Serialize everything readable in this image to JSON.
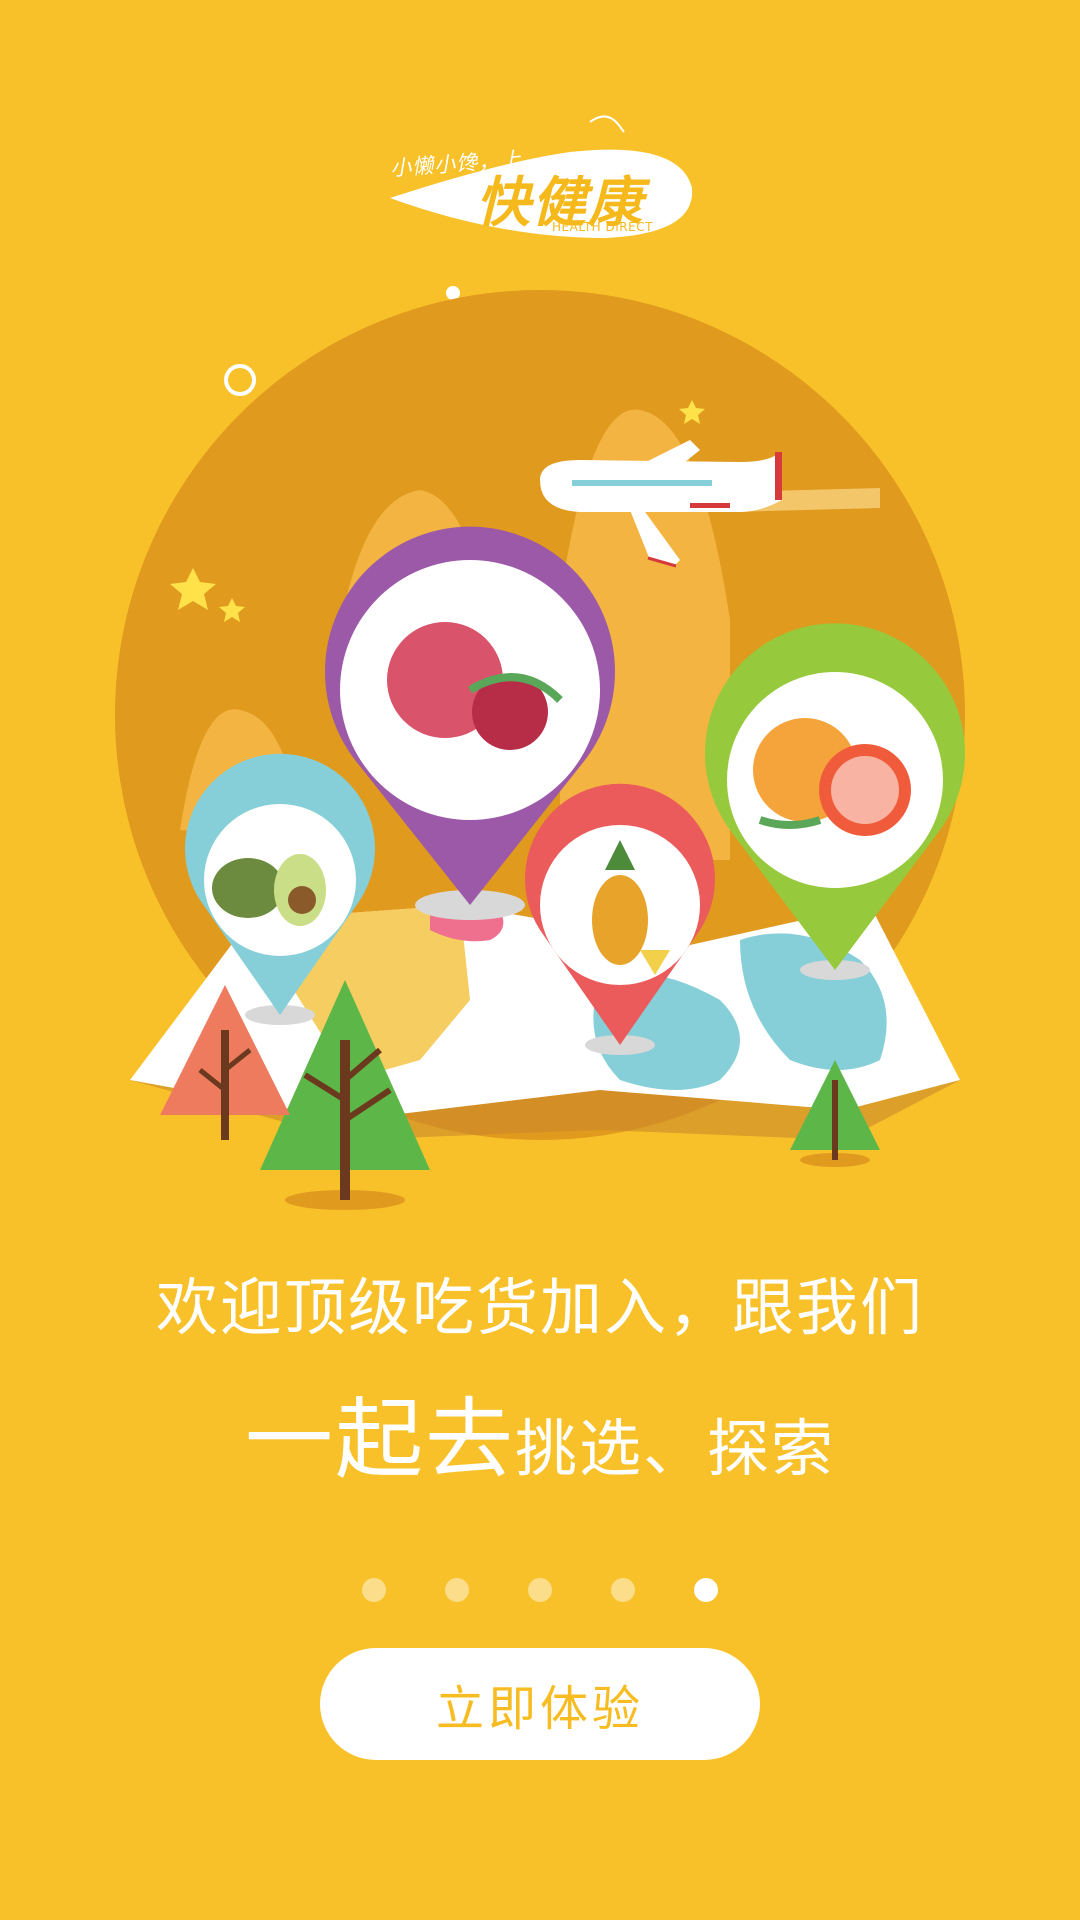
{
  "colors": {
    "background": "#F8C12A",
    "circle": "#E09A1E",
    "button_text": "#F6BC22",
    "pin_purple": "#9B59A8",
    "pin_blue": "#86CFD8",
    "pin_red": "#EC5B5B",
    "pin_green": "#97C93C"
  },
  "logo": {
    "tagline": "小懒小馋，上",
    "brand": "快健康",
    "subtitle": "HEALTH DIRECT"
  },
  "headline": {
    "line1": "欢迎顶级吃货加入，跟我们",
    "line2_emphasis": "一起去",
    "line2_rest": "挑选、探索"
  },
  "pagination": {
    "total": 5,
    "active_index": 4
  },
  "cta": {
    "label": "立即体验"
  },
  "illustration": {
    "pins": [
      {
        "fruit": "avocado-icon",
        "color": "pin_blue"
      },
      {
        "fruit": "pomegranate-icon",
        "color": "pin_purple"
      },
      {
        "fruit": "pineapple-icon",
        "color": "pin_red"
      },
      {
        "fruit": "grapefruit-icon",
        "color": "pin_green"
      }
    ],
    "decorations": [
      "airplane-icon",
      "star-icon",
      "tree-icon",
      "map-icon"
    ]
  }
}
